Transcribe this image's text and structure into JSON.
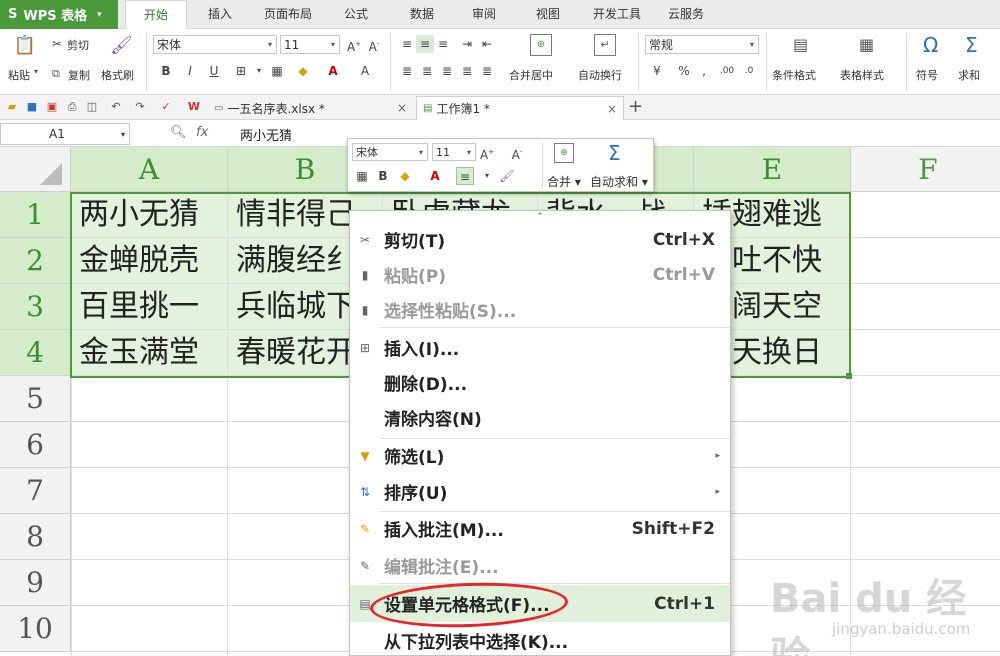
{
  "app": {
    "name": "WPS 表格",
    "logo": "S"
  },
  "menu_tabs": [
    "开始",
    "插入",
    "页面布局",
    "公式",
    "数据",
    "审阅",
    "视图",
    "开发工具",
    "云服务"
  ],
  "active_tab": "开始",
  "ribbon": {
    "cut": "剪切",
    "paste": "粘贴",
    "copy": "复制",
    "format_painter": "格式刷",
    "font_name": "宋体",
    "font_size": "11",
    "merge_center": "合并居中",
    "wrap_text": "自动换行",
    "number_format": "常规",
    "conditional_format": "条件格式",
    "table_style": "表格样式",
    "symbol": "符号",
    "sum": "求和"
  },
  "doc_tabs": [
    {
      "label": "一五名序表.xlsx *"
    },
    {
      "label": "工作簿1 *"
    }
  ],
  "formula_bar": {
    "name_box": "A1",
    "fx": "fx",
    "value": "两小无猜"
  },
  "columns": [
    "A",
    "B",
    "C",
    "D",
    "E",
    "F"
  ],
  "rows": [
    "1",
    "2",
    "3",
    "4",
    "5",
    "6",
    "7",
    "8",
    "9",
    "10"
  ],
  "cells": {
    "A": [
      "两小无猜",
      "金蝉脱壳",
      "百里挑一",
      "金玉满堂"
    ],
    "B": [
      "情非得已",
      "满腹经纶",
      "兵临城下",
      "春暖花开"
    ],
    "C": [
      "卧虎藏龙",
      "",
      "",
      ""
    ],
    "D": [
      "背水一战",
      "",
      "",
      ""
    ],
    "E": [
      "插翅难逃",
      "不吐不快",
      "海阔天空",
      "改天换日"
    ]
  },
  "visible_cells": {
    "A": [
      "两小无猜",
      "金蝉脱壳",
      "百里挑一",
      "金玉满堂"
    ],
    "B": [
      "情非得己",
      "满腹经纟",
      "兵临城下",
      "春暖花开"
    ],
    "E_partial": [
      "插翅难逃",
      "不吐不快",
      "海阔天空",
      "换天换日"
    ]
  },
  "mini_toolbar": {
    "font_name": "宋体",
    "font_size": "11",
    "merge": "合并",
    "autosum": "自动求和"
  },
  "context_menu": [
    {
      "label": "剪切(T)",
      "shortcut": "Ctrl+X",
      "icon": "scissors-icon",
      "disabled": false
    },
    {
      "label": "粘贴(P)",
      "shortcut": "Ctrl+V",
      "icon": "paste-icon",
      "disabled": true
    },
    {
      "label": "选择性粘贴(S)...",
      "shortcut": "",
      "icon": "paste-special-icon",
      "disabled": true
    },
    {
      "label": "插入(I)...",
      "shortcut": "",
      "icon": "insert-icon",
      "disabled": false
    },
    {
      "label": "删除(D)...",
      "shortcut": "",
      "icon": "",
      "disabled": false
    },
    {
      "label": "清除内容(N)",
      "shortcut": "",
      "icon": "",
      "disabled": false
    },
    {
      "label": "筛选(L)",
      "shortcut": "",
      "icon": "filter-icon",
      "disabled": false,
      "submenu": true
    },
    {
      "label": "排序(U)",
      "shortcut": "",
      "icon": "sort-icon",
      "disabled": false,
      "submenu": true
    },
    {
      "label": "插入批注(M)...",
      "shortcut": "Shift+F2",
      "icon": "comment-add-icon",
      "disabled": false
    },
    {
      "label": "编辑批注(E)...",
      "shortcut": "",
      "icon": "comment-edit-icon",
      "disabled": true
    },
    {
      "label": "设置单元格格式(F)...",
      "shortcut": "Ctrl+1",
      "icon": "format-cells-icon",
      "disabled": false,
      "highlighted": true
    },
    {
      "label": "从下拉列表中选择(K)...",
      "shortcut": "",
      "icon": "",
      "disabled": false
    }
  ],
  "watermark": {
    "brand": "Bai du 经验",
    "url": "jingyan.baidu.com"
  },
  "colors": {
    "accent": "#4a9a3c",
    "selection_fill": "#e3f2dc",
    "annotation": "#e8232a"
  }
}
